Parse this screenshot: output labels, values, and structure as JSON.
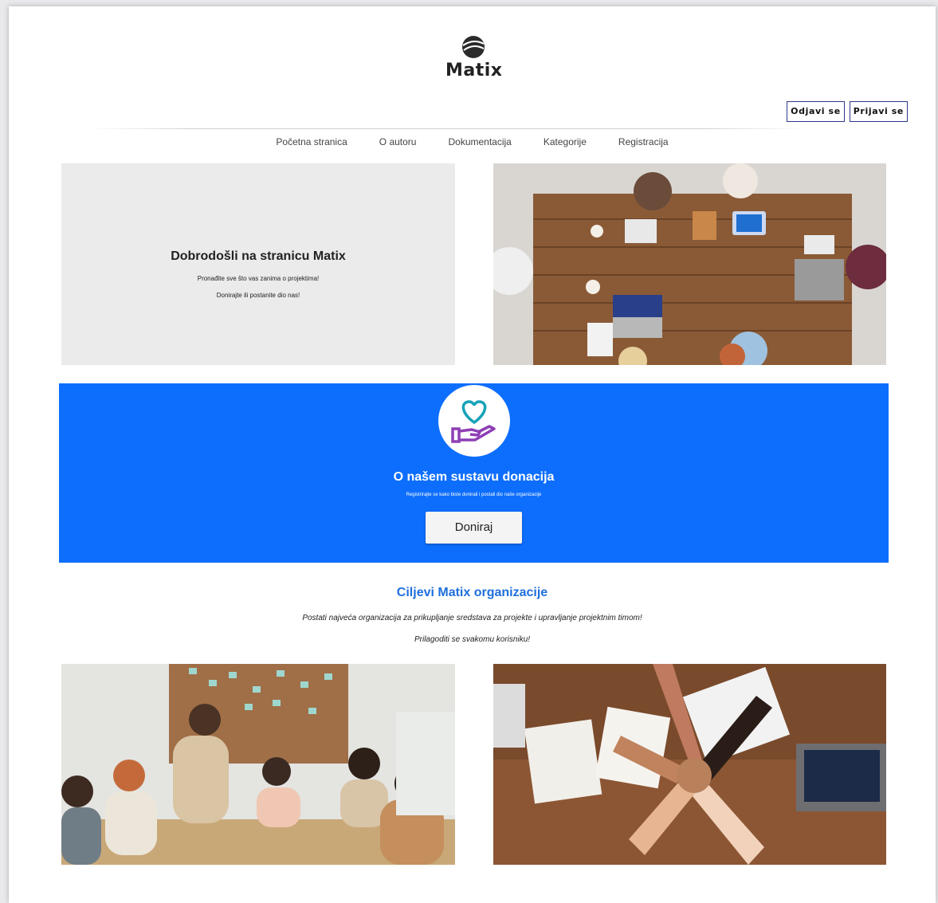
{
  "brand": {
    "name": "Matix"
  },
  "auth": {
    "logout_label": "Odjavi se",
    "login_label": "Prijavi se"
  },
  "nav": {
    "items": [
      {
        "label": "Početna stranica"
      },
      {
        "label": "O autoru"
      },
      {
        "label": "Dokumentacija"
      },
      {
        "label": "Kategorije"
      },
      {
        "label": "Registracija"
      }
    ]
  },
  "welcome": {
    "title": "Dobrodošli na stranicu Matix",
    "line1": "Pronađite sve što vas zanima o projektima!",
    "line2": "Donirajte ili postanite dio nas!"
  },
  "donate": {
    "title": "O našem sustavu donacija",
    "text": "Registrirajte se kako biste donirali i postali dio naše organizacije",
    "button_label": "Doniraj"
  },
  "goals": {
    "title": "Ciljevi Matix organizacije",
    "line1": "Postati najveća organizacija za prikupljanje sredstava za projekte i upravljanje projektnim timom!",
    "line2": "Prilagoditi se svakomu korisniku!"
  },
  "colors": {
    "donate_bg": "#0d6efd",
    "goals_title": "#1e6fdc",
    "heart_icon": "#17a2b8",
    "hand_icon": "#8e3fb5"
  }
}
